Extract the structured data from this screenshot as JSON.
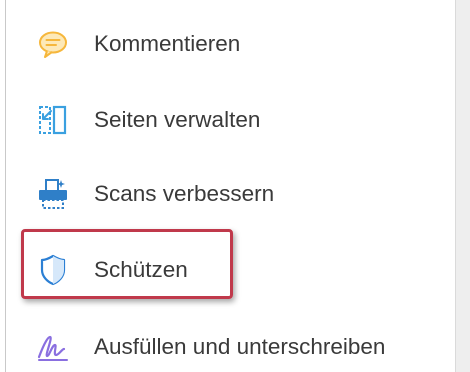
{
  "tools": [
    {
      "label": "Kommentieren",
      "icon": "comment-icon",
      "color": "#f6b73c"
    },
    {
      "label": "Seiten verwalten",
      "icon": "organize-pages-icon",
      "color": "#3aa0e0"
    },
    {
      "label": "Scans verbessern",
      "icon": "scan-icon",
      "color": "#2f7fc8"
    },
    {
      "label": "Schützen",
      "icon": "shield-icon",
      "color": "#2b7fd4"
    },
    {
      "label": "Ausfüllen und unterschreiben",
      "icon": "signature-icon",
      "color": "#8a6fe0"
    }
  ],
  "colors": {
    "highlight": "#c0394b",
    "text": "#3a3a3a"
  }
}
